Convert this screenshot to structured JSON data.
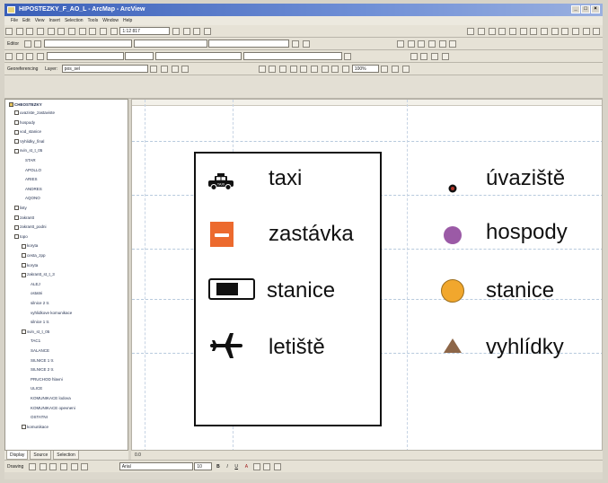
{
  "window": {
    "title": "HIPOSTEZKY_F_AO_L - ArcMap - ArcView",
    "controls": [
      "_",
      "□",
      "×"
    ]
  },
  "menu": [
    "File",
    "Edit",
    "View",
    "Insert",
    "Selection",
    "Tools",
    "Window",
    "Help"
  ],
  "toolbar": {
    "scale_value": "1:12 817",
    "zoom_value": "100%",
    "editor_label": "Editor",
    "georeferencing_label": "Georeferencing",
    "layer_label": "Layer:",
    "layer_value": "pos_sel",
    "font_label": "Arial",
    "font_size": "10",
    "drawing_label": "Drawing",
    "bold": "B",
    "italic": "I",
    "underline": "U",
    "font_color": "A"
  },
  "toc": {
    "root": "CHEOSTEZKY",
    "layers": [
      "uvaziste_zastaviste",
      "hospody",
      "vod_stanice",
      "Vyhlidky_final",
      "svin_st_t_05",
      "STAR",
      "APOLLO",
      "ARIES",
      "ANDRES",
      "AQONO",
      "listy",
      "zakrantt",
      "zakrantt_podni",
      "topo",
      "koryta",
      "cesta_zpp",
      "koryta",
      "zakrantt_st_t_3",
      "ALEJ",
      "ostatni",
      "silnice 2 tr.",
      "vyhlidkove komunikace",
      "silnice 1 tr.",
      "svin_st_t_05",
      "TAC1",
      "SALANCE",
      "SILNICE 1 tr.",
      "SILNICE 2 tr.",
      "PRUCHOD hlavni",
      "ULICE",
      "KOMUNIKACE lodova",
      "KOMUNIKACE opevneni",
      "OSTATNI",
      "komunikace"
    ],
    "tabs": [
      "Display",
      "Source",
      "Selection"
    ]
  },
  "legend": {
    "left_items": [
      "taxi",
      "zastávka",
      "stanice",
      "letiště"
    ],
    "right_items": [
      "úvaziště",
      "hospody",
      "stanice",
      "vyhlídky"
    ],
    "icons": {
      "taxi": "taxi-icon",
      "zastavka": "bus-stop-icon",
      "stanice_left": "station-icon",
      "letiste": "airplane-icon",
      "uvaziste": "mooring-icon",
      "hospody": "pub-icon",
      "stanice_right": "station-circle-icon",
      "vyhlidky": "viewpoint-icon"
    },
    "colors": {
      "bus_stop": "#ec6a2e",
      "pub": "#9b5aa6",
      "station_circle": "#f1a72d",
      "viewpoint": "#8d6648",
      "mooring": "#b23428"
    },
    "taxi_sign": "TAXI"
  },
  "bottom": {
    "page_status": "0.0"
  }
}
